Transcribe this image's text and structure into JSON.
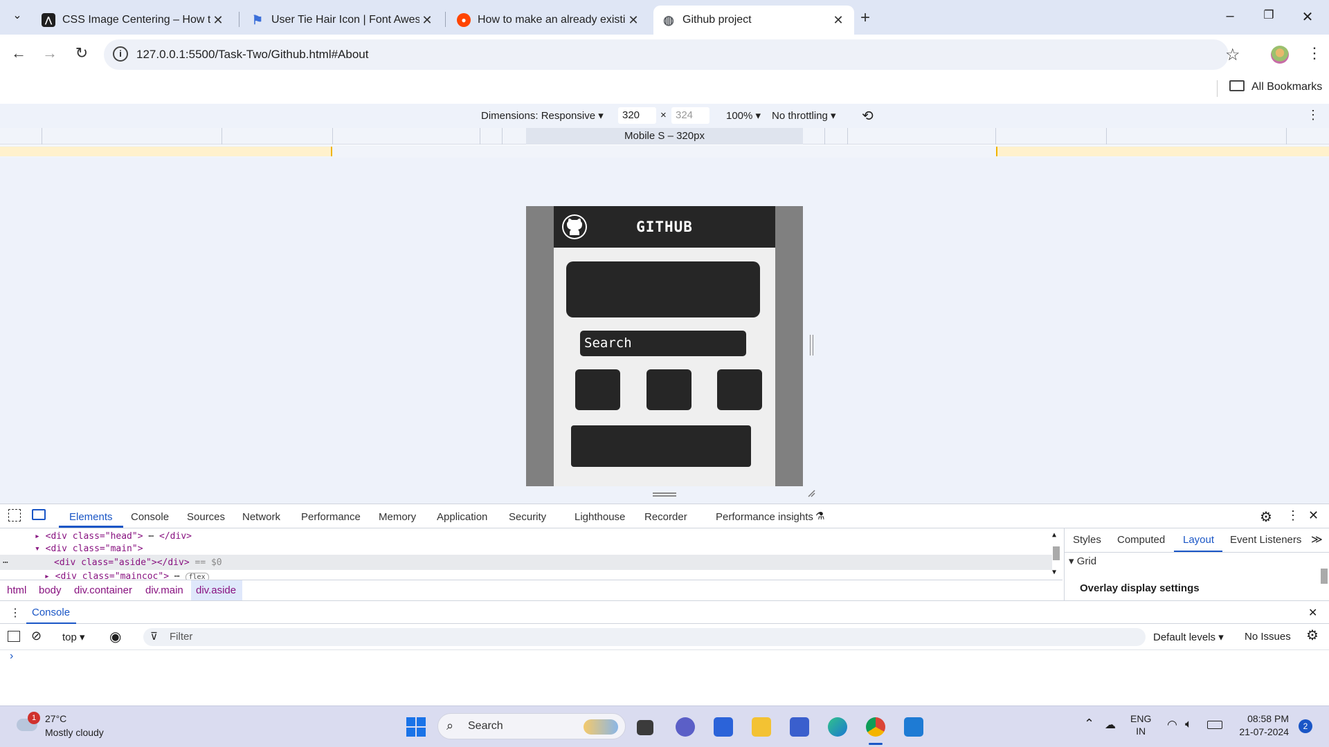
{
  "browser": {
    "tabs": [
      {
        "title": "CSS Image Centering – How to",
        "icon": "codepen-icon"
      },
      {
        "title": "User Tie Hair Icon | Font Aweso",
        "icon": "flag-icon"
      },
      {
        "title": "How to make an already existin",
        "icon": "reddit-icon"
      },
      {
        "title": "Github project",
        "icon": "globe-icon"
      }
    ],
    "url": "127.0.0.1:5500/Task-Two/Github.html#About",
    "all_bookmarks": "All Bookmarks"
  },
  "device_toolbar": {
    "dimensions_label": "Dimensions: Responsive",
    "width": "320",
    "height_placeholder": "324",
    "zoom": "100%",
    "throttling": "No throttling",
    "media_query_label": "Mobile S – 320px"
  },
  "page": {
    "title": "GITHUB",
    "search_label": "Search"
  },
  "devtools": {
    "tabs": [
      "Elements",
      "Console",
      "Sources",
      "Network",
      "Performance",
      "Memory",
      "Application",
      "Security",
      "Lighthouse",
      "Recorder",
      "Performance insights"
    ],
    "active_tab": "Elements",
    "dom": {
      "line1": "<div class=\"head\">",
      "line1_end": "</div>",
      "line2": "<div class=\"main\">",
      "line3": "<div class=\"aside\"></div>",
      "line3_suffix": "== $0",
      "line4": "<div class=\"maincoc\">",
      "line4_badge": "flex"
    },
    "breadcrumbs": [
      "html",
      "body",
      "div.container",
      "div.main",
      "div.aside"
    ],
    "side_tabs": [
      "Styles",
      "Computed",
      "Layout",
      "Event Listeners"
    ],
    "side_active": "Layout",
    "grid_label": "Grid",
    "overlay_label": "Overlay display settings",
    "console": {
      "tab": "Console",
      "context": "top",
      "filter_placeholder": "Filter",
      "levels": "Default levels",
      "issues": "No Issues"
    }
  },
  "taskbar": {
    "weather_temp": "27°C",
    "weather_desc": "Mostly cloudy",
    "weather_badge": "1",
    "search_label": "Search",
    "lang_line1": "ENG",
    "lang_line2": "IN",
    "time": "08:58 PM",
    "date": "21-07-2024",
    "notification_count": "2"
  },
  "colors": {
    "accent": "#1a56c6",
    "chrome_frame": "#dfe6f5",
    "page_header": "#262626"
  }
}
